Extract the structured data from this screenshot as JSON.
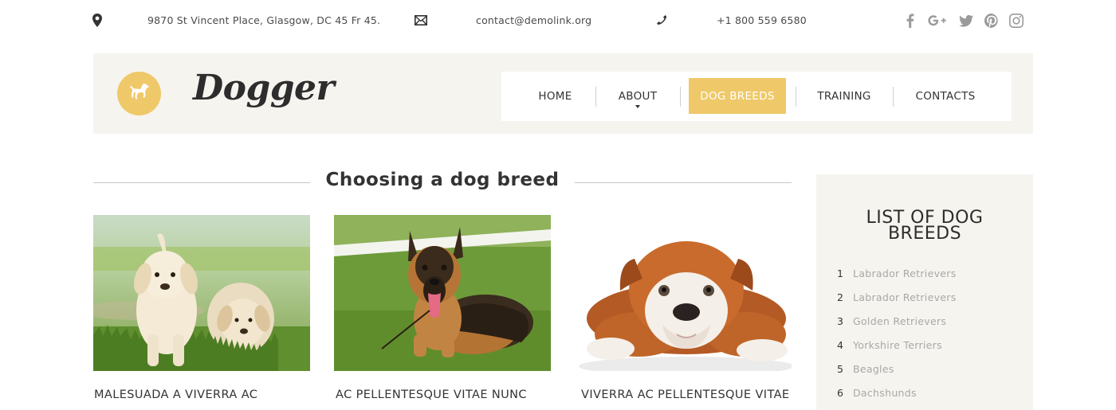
{
  "topbar": {
    "address": "9870 St Vincent Place, Glasgow, DC 45 Fr 45.",
    "email": "contact@demolink.org",
    "phone": "+1 800 559 6580",
    "icons": [
      "map-pin-icon",
      "envelope-icon",
      "phone-icon"
    ],
    "social": [
      "facebook-icon",
      "google-plus-icon",
      "twitter-icon",
      "pinterest-icon",
      "instagram-icon"
    ]
  },
  "header": {
    "logo_text": "Dogger",
    "logo_icon": "dog-icon",
    "accent_color": "#efc969",
    "nav": [
      {
        "label": "HOME"
      },
      {
        "label": "ABOUT"
      },
      {
        "label": "DOG BREEDS"
      },
      {
        "label": "TRAINING"
      },
      {
        "label": "CONTACTS"
      }
    ],
    "active_nav": "DOG BREEDS"
  },
  "main": {
    "section_title": "Choosing a dog breed",
    "cards": [
      {
        "title": "MALESUADA A VIVERRA AC",
        "image": "labrador-puppies-photo"
      },
      {
        "title": "AC PELLENTESQUE VITAE NUNC",
        "image": "german-shepherd-photo"
      },
      {
        "title": "VIVERRA AC PELLENTESQUE VITAE",
        "image": "bulldog-puppy-photo"
      }
    ]
  },
  "sidebar": {
    "title_line1": "LIST OF DOG",
    "title_line2": "BREEDS",
    "items": [
      {
        "num": "1",
        "label": "Labrador Retrievers"
      },
      {
        "num": "2",
        "label": "Labrador Retrievers"
      },
      {
        "num": "3",
        "label": "Golden Retrievers"
      },
      {
        "num": "4",
        "label": "Yorkshire Terriers"
      },
      {
        "num": "5",
        "label": "Beagles"
      },
      {
        "num": "6",
        "label": "Dachshunds"
      }
    ]
  }
}
